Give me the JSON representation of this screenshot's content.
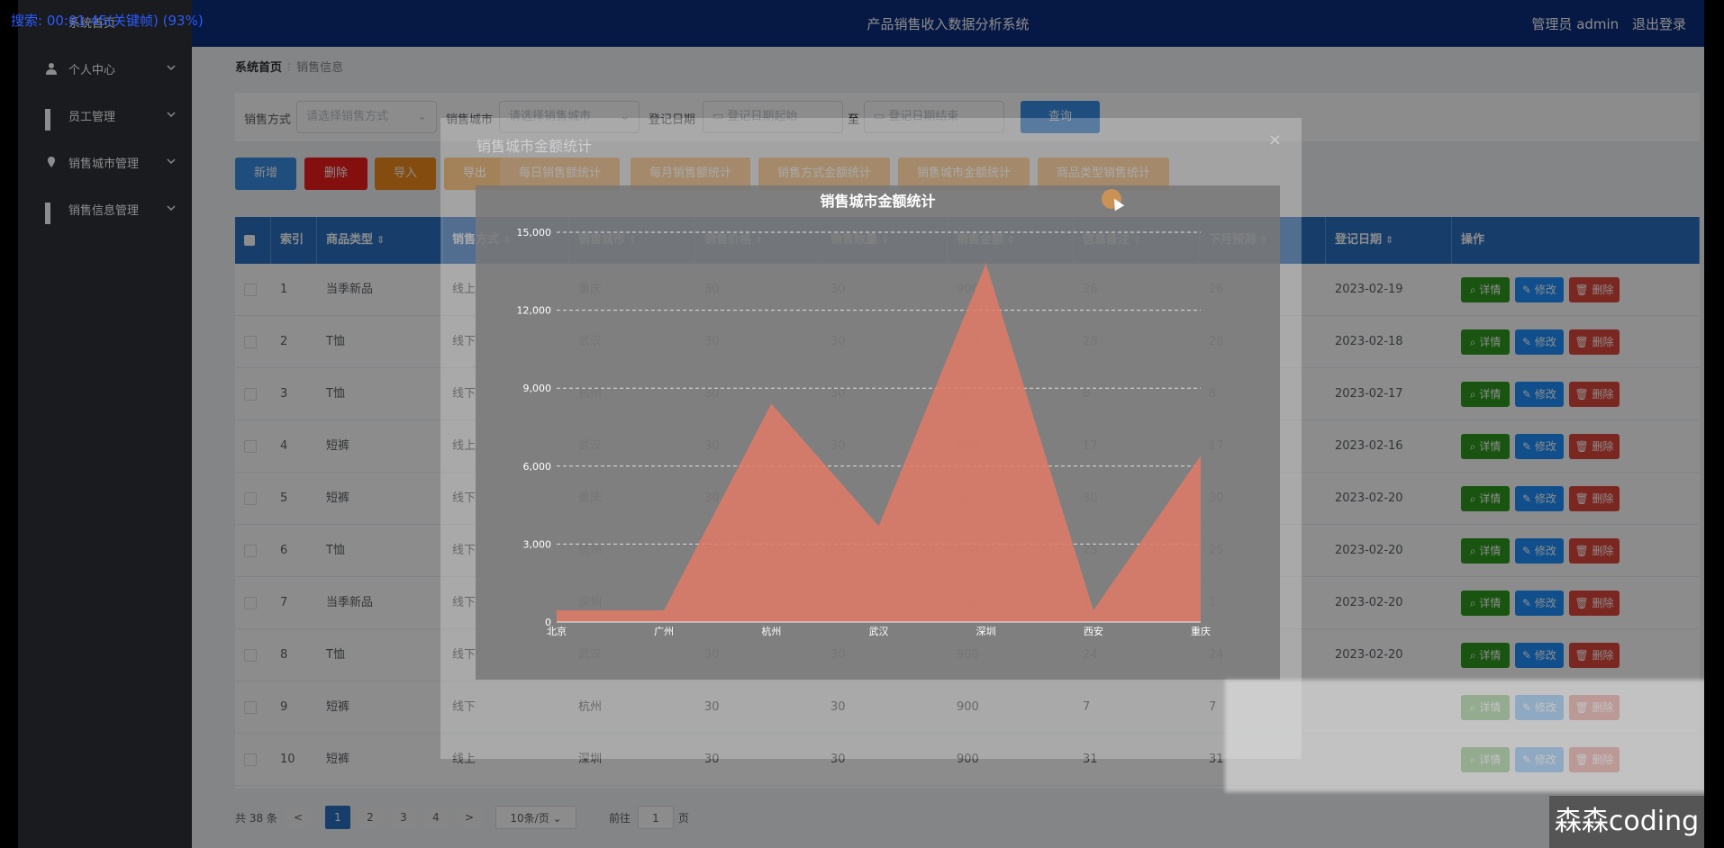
{
  "overlay_text": "搜索: 00:01:45(关键帧) (93%)",
  "sidebar": {
    "items": [
      {
        "label": "系统首页"
      },
      {
        "label": "个人中心"
      },
      {
        "label": "员工管理"
      },
      {
        "label": "销售城市管理"
      },
      {
        "label": "销售信息管理"
      }
    ]
  },
  "header": {
    "title": "产品销售收入数据分析系统",
    "user": "管理员 admin",
    "logout": "退出登录"
  },
  "breadcrumb": {
    "home": "系统首页",
    "current": "销售信息"
  },
  "search": {
    "method_label": "销售方式",
    "method_placeholder": "请选择销售方式",
    "city_label": "销售城市",
    "city_placeholder": "请选择销售城市",
    "date_label": "登记日期",
    "date_start": "登记日期起始",
    "date_to": "至",
    "date_end": "登记日期结束",
    "query": "查询"
  },
  "actions": [
    {
      "label": "新增",
      "color": "#3a8ee6"
    },
    {
      "label": "删除",
      "color": "#f11c1c"
    },
    {
      "label": "导入",
      "color": "#f08a1c"
    },
    {
      "label": "导出",
      "color": "#f0a040"
    },
    {
      "label": "每日销售额统计",
      "color": "#f5b56a"
    },
    {
      "label": "每月销售额统计",
      "color": "#f5b56a"
    },
    {
      "label": "销售方式金额统计",
      "color": "#f5b56a"
    },
    {
      "label": "销售城市金额统计",
      "color": "#f5b56a"
    },
    {
      "label": "商品类型销售统计",
      "color": "#f5b56a"
    }
  ],
  "table": {
    "headers": [
      "索引",
      "商品类型",
      "销售方式",
      "销售城市",
      "销售价格",
      "销售数量",
      "销售金额",
      "信息备注",
      "下月预测",
      "登记日期",
      "操作"
    ],
    "rows": [
      [
        "1",
        "当季新品",
        "线上",
        "重庆",
        "30",
        "30",
        "900",
        "26",
        "26",
        "2023-02-19"
      ],
      [
        "2",
        "T恤",
        "线下",
        "武汉",
        "30",
        "30",
        "900",
        "28",
        "28",
        "2023-02-18"
      ],
      [
        "3",
        "T恤",
        "线下",
        "杭州",
        "30",
        "30",
        "900",
        "8",
        "8",
        "2023-02-17"
      ],
      [
        "4",
        "短裤",
        "线上",
        "武汉",
        "30",
        "30",
        "900",
        "17",
        "17",
        "2023-02-16"
      ],
      [
        "5",
        "短裤",
        "线下",
        "重庆",
        "30",
        "30",
        "900",
        "30",
        "30",
        "2023-02-20"
      ],
      [
        "6",
        "T恤",
        "线下",
        "杭州",
        "30",
        "30",
        "900",
        "25",
        "25",
        "2023-02-20"
      ],
      [
        "7",
        "当季新品",
        "线下",
        "深圳",
        "30",
        "30",
        "900",
        "1",
        "1",
        "2023-02-20"
      ],
      [
        "8",
        "T恤",
        "线下",
        "武汉",
        "30",
        "30",
        "900",
        "24",
        "24",
        "2023-02-20"
      ],
      [
        "9",
        "短裤",
        "线下",
        "杭州",
        "30",
        "30",
        "900",
        "7",
        "7",
        ""
      ],
      [
        "10",
        "短裤",
        "线上",
        "深圳",
        "30",
        "30",
        "900",
        "31",
        "31",
        ""
      ]
    ],
    "op_detail": "详情",
    "op_edit": "修改",
    "op_delete": "删除"
  },
  "pager": {
    "total": "共 38 条",
    "prev": "<",
    "pages": [
      "1",
      "2",
      "3",
      "4"
    ],
    "next": ">",
    "size": "10条/页",
    "goto_label": "前往",
    "goto_value": "1",
    "goto_unit": "页"
  },
  "dialog": {
    "title": "销售城市金额统计",
    "close": "×"
  },
  "chart_data": {
    "type": "area",
    "title": "销售城市金额统计",
    "categories": [
      "北京",
      "广州",
      "杭州",
      "武汉",
      "深圳",
      "西安",
      "重庆"
    ],
    "values": [
      450,
      450,
      8400,
      3700,
      13800,
      450,
      6400
    ],
    "ylim": [
      0,
      15000
    ],
    "yticks": [
      0,
      3000,
      6000,
      9000,
      12000,
      15000
    ],
    "ytick_labels": [
      "0",
      "3,000",
      "6,000",
      "9,000",
      "12,000",
      "15,000"
    ],
    "color": "#e07a66",
    "grid": true
  },
  "watermark": "森森coding"
}
